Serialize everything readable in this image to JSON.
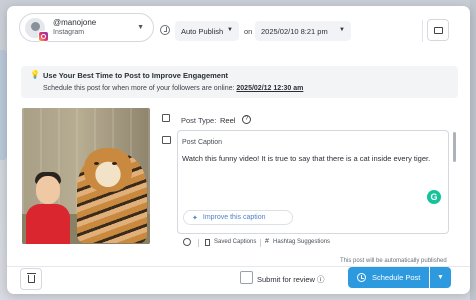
{
  "account": {
    "name": "@manojone",
    "platform": "Instagram"
  },
  "publish": {
    "mode": "Auto Publish",
    "on_label": "on",
    "datetime": "2025/02/10 8:21 pm"
  },
  "banner": {
    "title": "Use Your Best Time to Post to Improve Engagement",
    "subtitle": "Schedule this post for when more of your followers are online:",
    "best_time": "2025/02/12 12:30 am"
  },
  "post": {
    "type_label": "Post Type:",
    "type_value": "Reel",
    "help_glyph": "?",
    "caption_label": "Post Caption",
    "caption_text": "Watch this funny video! It is true to say that there is a cat inside every tiger.",
    "improve_label": "Improve this caption",
    "grammarly_glyph": "G"
  },
  "tools": {
    "saved_captions": "Saved Captions",
    "hashtag_suggestions": "Hashtag Suggestions"
  },
  "footer": {
    "auto_note": "This post will be automatically published",
    "review_label": "Submit for review",
    "review_info": "ⓘ",
    "schedule_label": "Schedule Post",
    "dropdown_glyph": "▼"
  },
  "colors": {
    "accent": "#2d9ae0",
    "grammarly": "#15c39a",
    "shirt": "#d9262f"
  }
}
